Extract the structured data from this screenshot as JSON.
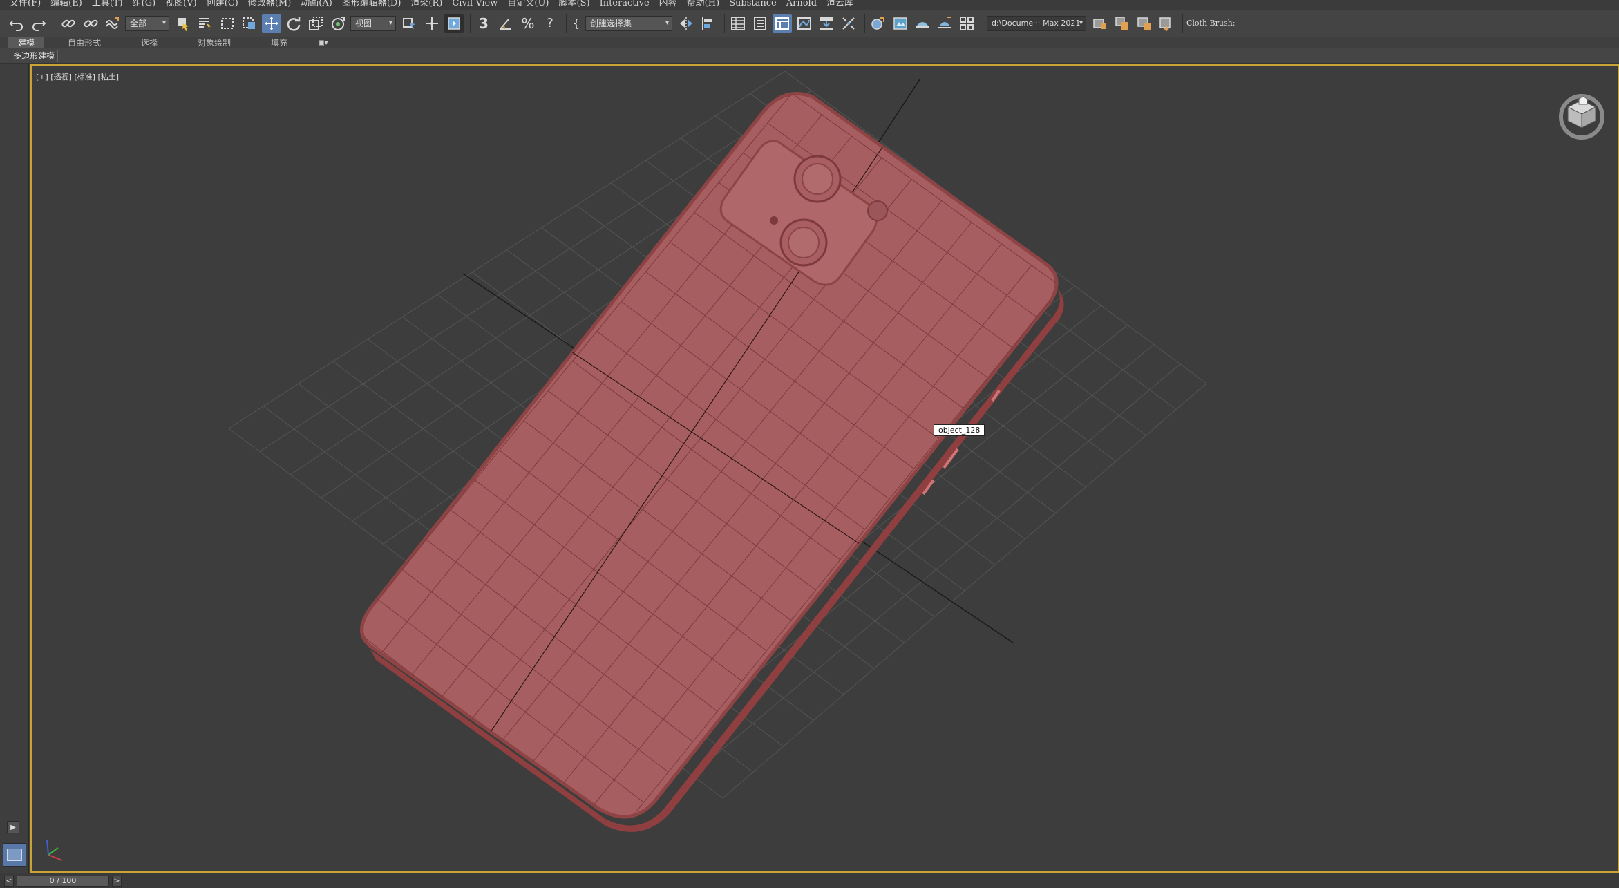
{
  "menubar": {
    "items": [
      "文件(F)",
      "编辑(E)",
      "工具(T)",
      "组(G)",
      "视图(V)",
      "创建(C)",
      "修改器(M)",
      "动画(A)",
      "图形编辑器(D)",
      "渲染(R)",
      "Civil View",
      "自定义(U)",
      "脚本(S)",
      "Interactive",
      "内容",
      "帮助(H)",
      "Substance",
      "Arnold",
      "渲云库"
    ]
  },
  "toolbar": {
    "selection_filter": "全部",
    "reference_coord": "视图",
    "named_selection_set": "创建选择集",
    "project_path": "d:\\Docume··· Max 2021",
    "cloth_brush": "Cloth Brush:",
    "snap_label": "3",
    "angle_snap_label": "A",
    "percent_snap_label": "%",
    "spinner_snap_label": "?",
    "icons": [
      "undo-icon",
      "redo-icon",
      "link-icon",
      "unlink-icon",
      "bind-space-warp-icon",
      "select-object-icon",
      "select-by-name-icon",
      "rectangle-select-icon",
      "window-crossing-icon",
      "move-icon",
      "rotate-icon",
      "scale-icon",
      "placement-icon",
      "mirror-icon",
      "align-icon",
      "layer-explorer-icon",
      "scene-explorer-icon",
      "graph-editor-icon",
      "material-editor-icon",
      "render-setup-icon",
      "render-frame-icon",
      "render-icon"
    ]
  },
  "ribbon": {
    "tabs": [
      "建模",
      "自由形式",
      "选择",
      "对象绘制",
      "填充"
    ],
    "selected_tab": "建模",
    "panel_label": "多边形建模"
  },
  "viewport": {
    "label": "[+] [透视] [标准] [粘土]",
    "object_tag": "object_128",
    "active_border_color": "#c9a336",
    "object_color": "#b56a6b"
  },
  "timeline": {
    "frame_display": "0 / 100",
    "prev_label": "<",
    "next_label": ">"
  }
}
